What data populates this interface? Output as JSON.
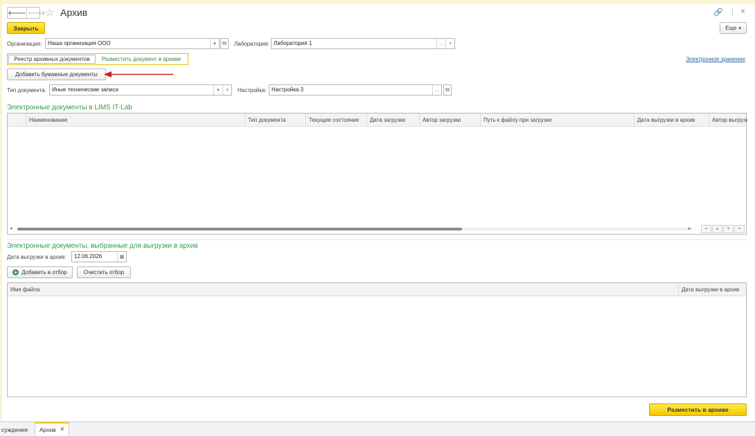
{
  "window": {
    "title": "Архив",
    "more_label": "Еще",
    "more_caret": "▾",
    "back_glyph": "🡐",
    "forward_glyph": "🡒",
    "star_glyph": "☆",
    "link_glyph": "🔗",
    "menu_glyph": "⋮",
    "close_glyph": "×"
  },
  "toolbar": {
    "close_label": "Закрыть"
  },
  "filters": {
    "org_label": "Организация:",
    "org_value": "Наша организация ООО",
    "lab_label": "Лаборатория:",
    "lab_value": "Лаборатория 1",
    "doc_type_label": "Тип документа:",
    "doc_type_value": "Иные технические записи",
    "setting_label": "Настройка:",
    "setting_value": "Настройка 3"
  },
  "tabs": [
    {
      "label": "Реестр архивных документов"
    },
    {
      "label": "Разместить документ в архиве"
    }
  ],
  "add_paper_label": "Добавить бумажные документы",
  "e_storage_link": "Электронное хранение",
  "section1": {
    "title": "Электронные документы в LIMS IT-Lab",
    "columns": [
      "Наименование",
      "Тип документа",
      "Текущее состояние",
      "Дата загрузки",
      "Автор загрузки",
      "Путь к файлу при загрузке",
      "Дата выгрузки в архив",
      "Автор выгрузки"
    ]
  },
  "section2": {
    "title": "Электронные документы, выбранные для выгрузки в архив",
    "date_label": "Дата выгрузки в архив:",
    "date_value": "12.06.2026",
    "add_filter_label": "Добавить в отбор",
    "clear_filter_label": "Очистить отбор",
    "columns": [
      "Имя файла",
      "Дата выгрузки в архив"
    ]
  },
  "place_button_label": "Разместить в архиве",
  "bottom_tabs": [
    {
      "label": "суждения"
    },
    {
      "label": "Архив"
    }
  ],
  "colors": {
    "accent_yellow": "#f5c800",
    "section_green": "#2e9e4a",
    "link_blue": "#2c5fad",
    "arrow_red": "#c8202a"
  }
}
